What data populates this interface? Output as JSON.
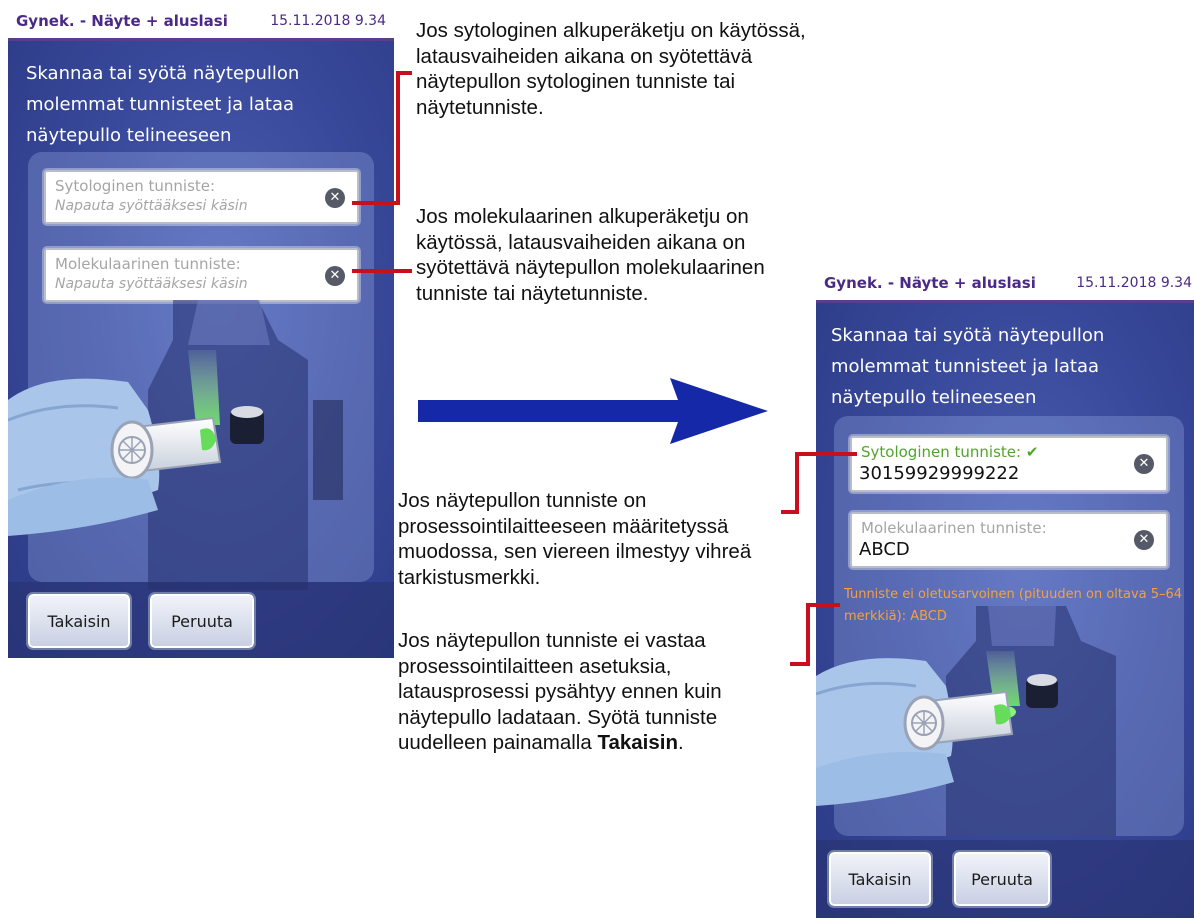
{
  "left_screen": {
    "header": {
      "title": "Gynek. - Näyte + aluslasi",
      "datetime": "15.11.2018 9.34"
    },
    "instruction": "Skannaa tai syötä näytepullon molemmat tunnisteet ja lataa näytepullo telineeseen",
    "field1": {
      "label": "Sytologinen tunniste:",
      "placeholder": "Napauta syöttääksesi käsin"
    },
    "field2": {
      "label": "Molekulaarinen tunniste:",
      "placeholder": "Napauta syöttääksesi käsin"
    },
    "buttons": {
      "back": "Takaisin",
      "cancel": "Peruuta"
    }
  },
  "right_screen": {
    "header": {
      "title": "Gynek. - Näyte + aluslasi",
      "datetime": "15.11.2018 9.34"
    },
    "instruction": "Skannaa tai syötä näytepullon molemmat tunnisteet ja lataa näytepullo telineeseen",
    "field1": {
      "label": "Sytologinen tunniste:",
      "checkmark": "✔",
      "value": "30159929999222"
    },
    "field2": {
      "label": "Molekulaarinen tunniste:",
      "value": "ABCD"
    },
    "warning": "Tunniste ei oletusarvoinen (pituuden on oltava 5–64 merkkiä): ABCD",
    "buttons": {
      "back": "Takaisin",
      "cancel": "Peruuta"
    }
  },
  "annotations": {
    "cytology_note": "Jos sytologinen alkuperäketju on käytössä, latausvaiheiden aikana on syötettävä näytepullon sytologinen tunniste tai näytetunniste.",
    "molecular_note": "Jos molekulaarinen alkuperäketju on käytössä, latausvaiheiden aikana on syötettävä näytepullon molekulaarinen tunniste tai näytetunniste.",
    "format_note": "Jos näytepullon tunniste on prosessointilaitteeseen määritetyssä muodossa, sen viereen ilmestyy vihreä tarkistusmerkki.",
    "mismatch_note_prefix": "Jos näytepullon tunniste ei vastaa prosessointilaitteen asetuksia, latausprosessi pysähtyy ennen kuin näytepullo ladataan. Syötä tunniste uudelleen painamalla ",
    "mismatch_note_bold": "Takaisin",
    "mismatch_note_suffix": "."
  },
  "colors": {
    "header_text": "#4a2a86",
    "screen_blue": "#3a4a9c",
    "check_green": "#51a52c",
    "warning_orange": "#f2a23c",
    "callout_red": "#c80f1c",
    "arrow_blue": "#1428a8"
  },
  "icons": {
    "clear_field": "clear-x-icon",
    "process_arrow": "right-arrow-icon",
    "vial_illustration": "hand-holding-vial-scanner"
  }
}
